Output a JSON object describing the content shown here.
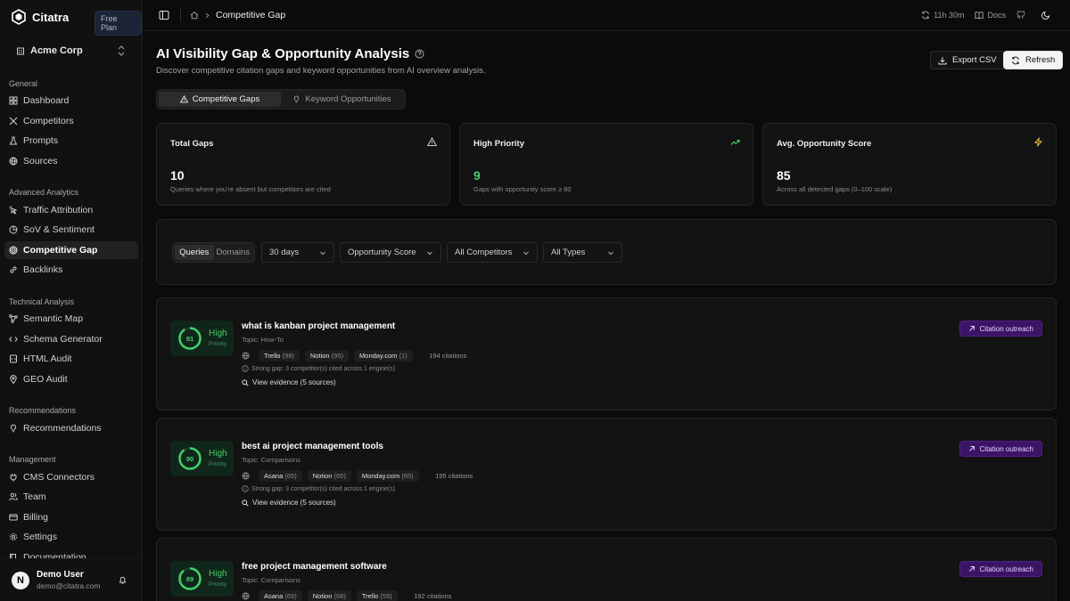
{
  "brand": {
    "name": "Citatra",
    "plan": "Free Plan"
  },
  "org": {
    "name": "Acme Corp"
  },
  "sidebar": {
    "sections": [
      {
        "label": "General",
        "items": [
          {
            "label": "Dashboard",
            "icon": "dashboard-icon"
          },
          {
            "label": "Competitors",
            "icon": "swords-icon"
          },
          {
            "label": "Prompts",
            "icon": "flask-icon"
          },
          {
            "label": "Sources",
            "icon": "globe-icon"
          }
        ]
      },
      {
        "label": "Advanced Analytics",
        "items": [
          {
            "label": "Traffic Attribution",
            "icon": "cursor-click-icon"
          },
          {
            "label": "SoV & Sentiment",
            "icon": "pie-chart-icon"
          },
          {
            "label": "Competitive Gap",
            "icon": "target-icon",
            "active": true
          },
          {
            "label": "Backlinks",
            "icon": "link-icon"
          }
        ]
      },
      {
        "label": "Technical Analysis",
        "items": [
          {
            "label": "Semantic Map",
            "icon": "network-icon"
          },
          {
            "label": "Schema Generator",
            "icon": "code-icon"
          },
          {
            "label": "HTML Audit",
            "icon": "file-code-icon"
          },
          {
            "label": "GEO Audit",
            "icon": "map-pin-icon"
          }
        ]
      },
      {
        "label": "Recommendations",
        "items": [
          {
            "label": "Recommendations",
            "icon": "lightbulb-icon"
          }
        ]
      },
      {
        "label": "Management",
        "items": [
          {
            "label": "CMS Connectors",
            "icon": "plug-icon"
          },
          {
            "label": "Team",
            "icon": "users-icon"
          },
          {
            "label": "Billing",
            "icon": "credit-card-icon"
          },
          {
            "label": "Settings",
            "icon": "gear-icon"
          },
          {
            "label": "Documentation",
            "icon": "book-icon"
          }
        ]
      }
    ]
  },
  "user": {
    "initial": "N",
    "name": "Demo User",
    "email": "demo@citatra.com"
  },
  "topbar": {
    "breadcrumb": "Competitive Gap",
    "timer": "11h 30m",
    "docs": "Docs"
  },
  "page": {
    "title": "AI Visibility Gap & Opportunity Analysis",
    "subtitle": "Discover competitive citation gaps and keyword opportunities from AI overview analysis.",
    "export_label": "Export CSV",
    "refresh_label": "Refresh"
  },
  "tabs": [
    {
      "label": "Competitive Gaps",
      "active": true
    },
    {
      "label": "Keyword Opportunities",
      "active": false
    }
  ],
  "stats": [
    {
      "label": "Total Gaps",
      "value": "10",
      "desc": "Queries where you're absent but competitors are cited",
      "icon": "warning-icon",
      "color": "#cfcfcf"
    },
    {
      "label": "High Priority",
      "value": "9",
      "desc": "Gaps with opportunity score ≥ 80",
      "icon": "trending-up-icon",
      "color": "#3fd06a"
    },
    {
      "label": "Avg. Opportunity Score",
      "value": "85",
      "desc": "Across all detected gaps (0–100 scale)",
      "icon": "lightning-icon",
      "color": "#e8b93a"
    }
  ],
  "filters": {
    "segment": [
      {
        "label": "Queries",
        "active": true
      },
      {
        "label": "Domains",
        "active": false
      }
    ],
    "range": "30 days",
    "sort": "Opportunity Score",
    "competitors": "All Competitors",
    "types": "All Types"
  },
  "gaps": [
    {
      "score": 91,
      "level": "High",
      "level_label": "Priority",
      "query": "what is kanban project management",
      "topic": "Topic: How-To",
      "competitors": [
        {
          "name": "Trello",
          "score": "(98)"
        },
        {
          "name": "Notion",
          "score": "(95)"
        },
        {
          "name": "Monday.com",
          "score": "(1)"
        }
      ],
      "citations": "194 citations",
      "gap_text": "Strong gap: 3 competitor(s) cited across 1 engine(s)",
      "evidence": "View evidence (5 sources)",
      "action": "Citation outreach"
    },
    {
      "score": 90,
      "level": "High",
      "level_label": "Priority",
      "query": "best ai project management tools",
      "topic": "Topic: Comparisons",
      "competitors": [
        {
          "name": "Asana",
          "score": "(65)"
        },
        {
          "name": "Notion",
          "score": "(65)"
        },
        {
          "name": "Monday.com",
          "score": "(65)"
        }
      ],
      "citations": "195 citations",
      "gap_text": "Strong gap: 3 competitor(s) cited across 1 engine(s)",
      "evidence": "View evidence (5 sources)",
      "action": "Citation outreach"
    },
    {
      "score": 89,
      "level": "High",
      "level_label": "Priority",
      "query": "free project management software",
      "topic": "Topic: Comparisons",
      "competitors": [
        {
          "name": "Asana",
          "score": "(69)"
        },
        {
          "name": "Notion",
          "score": "(68)"
        },
        {
          "name": "Trello",
          "score": "(55)"
        }
      ],
      "citations": "192 citations",
      "gap_text": "",
      "evidence": "",
      "action": "Citation outreach"
    }
  ]
}
